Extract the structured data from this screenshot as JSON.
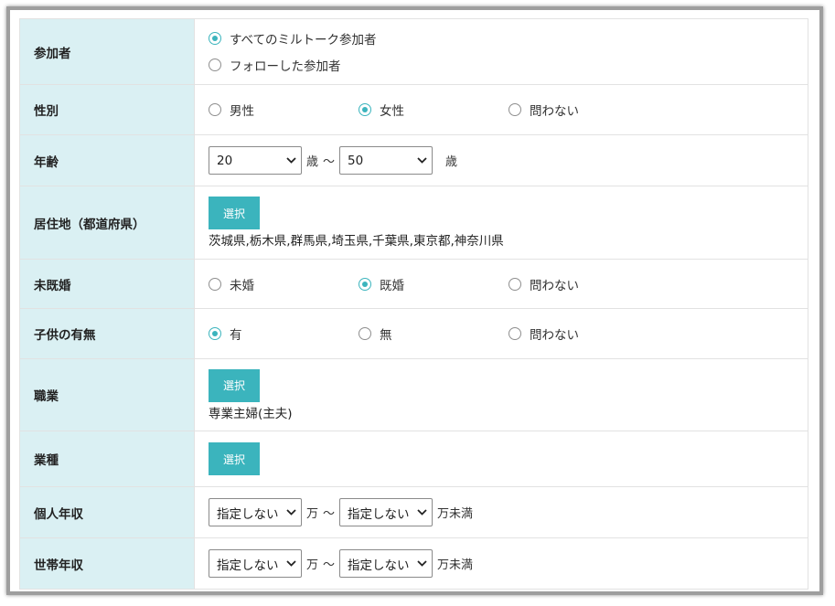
{
  "colors": {
    "accent": "#3bb4bd",
    "label_bg": "#daf0f3"
  },
  "rows": {
    "participants": {
      "label": "参加者",
      "options": [
        "すべてのミルトーク参加者",
        "フォローした参加者"
      ],
      "selected": 0
    },
    "gender": {
      "label": "性別",
      "options": [
        "男性",
        "女性",
        "問わない"
      ],
      "selected": 1
    },
    "age": {
      "label": "年齢",
      "min": "20",
      "min_unit": "歳",
      "tilde": "〜",
      "max": "50",
      "max_unit": "歳"
    },
    "residence": {
      "label": "居住地（都道府県）",
      "button": "選択",
      "selected_text": "茨城県,栃木県,群馬県,埼玉県,千葉県,東京都,神奈川県"
    },
    "marital": {
      "label": "未既婚",
      "options": [
        "未婚",
        "既婚",
        "問わない"
      ],
      "selected": 1
    },
    "children": {
      "label": "子供の有無",
      "options": [
        "有",
        "無",
        "問わない"
      ],
      "selected": 0
    },
    "occupation": {
      "label": "職業",
      "button": "選択",
      "selected_text": "専業主婦(主夫)"
    },
    "industry": {
      "label": "業種",
      "button": "選択"
    },
    "personal_income": {
      "label": "個人年収",
      "min": "指定しない",
      "unit": "万",
      "tilde": "〜",
      "max": "指定しない",
      "max_unit": "万未満"
    },
    "household_income": {
      "label": "世帯年収",
      "min": "指定しない",
      "unit": "万",
      "tilde": "〜",
      "max": "指定しない",
      "max_unit": "万未満"
    }
  }
}
